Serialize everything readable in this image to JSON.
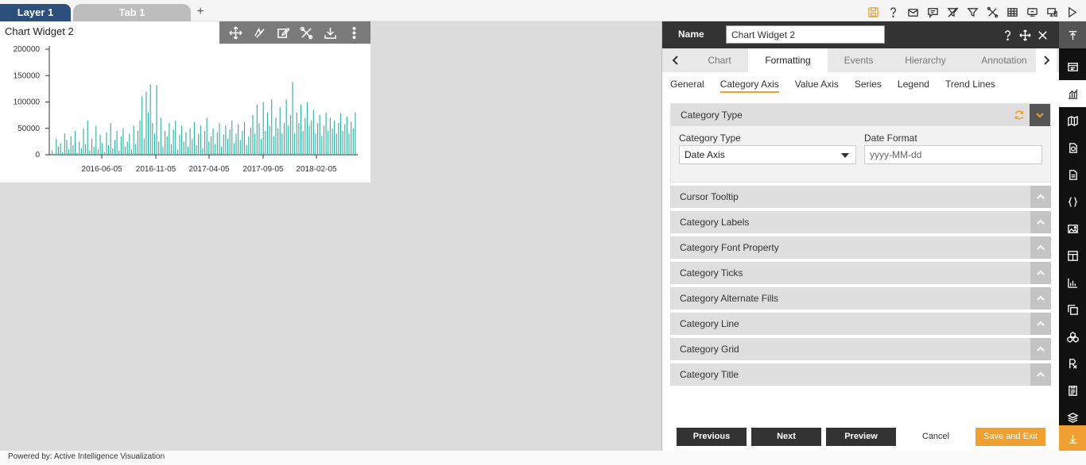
{
  "tabs": {
    "layer": "Layer 1",
    "tab": "Tab 1",
    "add": "+"
  },
  "widget": {
    "title": "Chart Widget 2"
  },
  "chart_data": {
    "type": "bar",
    "title": "Chart Widget 2",
    "ylim": [
      0,
      200000
    ],
    "yticks": [
      "200000",
      "150000",
      "100000",
      "50000",
      "0"
    ],
    "xticks": [
      "2016-06-05",
      "2016-11-05",
      "2017-04-05",
      "2017-09-05",
      "2018-02-05"
    ],
    "color": "#2ab0a0",
    "values": [
      8000,
      2000,
      30000,
      15000,
      22000,
      5000,
      40000,
      28000,
      10000,
      35000,
      18000,
      45000,
      3000,
      25000,
      12000,
      50000,
      20000,
      65000,
      8000,
      30000,
      15000,
      55000,
      10000,
      38000,
      22000,
      5000,
      42000,
      18000,
      60000,
      12000,
      28000,
      45000,
      8000,
      35000,
      50000,
      15000,
      25000,
      40000,
      10000,
      55000,
      20000,
      45000,
      65000,
      110000,
      30000,
      120000,
      80000,
      133000,
      60000,
      40000,
      132000,
      25000,
      70000,
      15000,
      45000,
      35000,
      60000,
      20000,
      48000,
      65000,
      10000,
      38000,
      55000,
      25000,
      42000,
      15000,
      50000,
      30000,
      62000,
      18000,
      40000,
      55000,
      12000,
      45000,
      70000,
      25000,
      35000,
      50000,
      20000,
      42000,
      60000,
      15000,
      38000,
      55000,
      30000,
      48000,
      65000,
      22000,
      40000,
      58000,
      28000,
      45000,
      62000,
      18000,
      35000,
      52000,
      75000,
      40000,
      95000,
      60000,
      30000,
      100000,
      45000,
      80000,
      55000,
      105000,
      35000,
      70000,
      50000,
      90000,
      40000,
      60000,
      105000,
      55000,
      75000,
      138000,
      40000,
      80000,
      60000,
      95000,
      45000,
      70000,
      100000,
      55000,
      65000,
      85000,
      40000,
      60000,
      75000,
      35000,
      55000,
      80000,
      45000,
      70000,
      50000,
      65000,
      40000,
      60000,
      78000,
      45000,
      58000,
      72000,
      40000,
      62000,
      50000,
      80000
    ]
  },
  "top_icons": [
    "save-icon",
    "help-icon",
    "mail-icon",
    "comment-icon",
    "clear-filter-icon",
    "filter-icon",
    "tools-icon",
    "table-icon",
    "screen-icon",
    "monitor-icon",
    "play-icon"
  ],
  "panel": {
    "name_label": "Name",
    "name_value": "Chart Widget 2",
    "main_tabs": [
      "Chart",
      "Formatting",
      "Events",
      "Hierarchy",
      "Annotation"
    ],
    "active_main_tab": "Formatting",
    "sub_tabs": [
      "General",
      "Category Axis",
      "Value Axis",
      "Series",
      "Legend",
      "Trend Lines"
    ],
    "active_sub_tab": "Category Axis",
    "open_section": {
      "title": "Category Type",
      "field1_label": "Category Type",
      "field1_value": "Date Axis",
      "field2_label": "Date Format",
      "field2_placeholder": "yyyy-MM-dd"
    },
    "sections": [
      "Cursor Tooltip",
      "Category Labels",
      "Category Font Property",
      "Category Ticks",
      "Category Alternate Fills",
      "Category Line",
      "Category Grid",
      "Category Title"
    ],
    "buttons": {
      "previous": "Previous",
      "next": "Next",
      "preview": "Preview",
      "cancel": "Cancel",
      "save": "Save and Exit"
    }
  },
  "footer": {
    "text": "Powered by: Active Intelligence Visualization"
  },
  "accent": "#f0a030",
  "header_bg": "#333333",
  "layer_tab_bg": "#2d4f7c"
}
